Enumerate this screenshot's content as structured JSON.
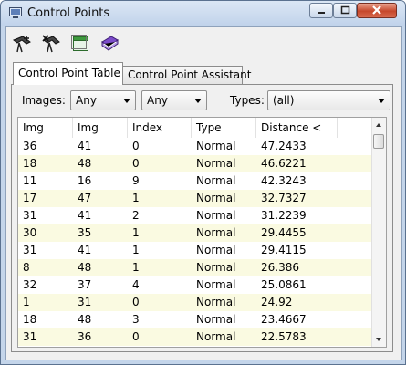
{
  "window": {
    "title": "Control Points"
  },
  "toolbar": {
    "icons": [
      "add-point-icon",
      "remove-point-icon",
      "window-icon",
      "book-icon"
    ]
  },
  "tabs": [
    {
      "label": "Control Point Table",
      "active": true
    },
    {
      "label": "Control Point Assistant",
      "active": false
    }
  ],
  "filters": {
    "images_label": "Images:",
    "images_a": "Any",
    "images_b": "Any",
    "types_label": "Types:",
    "types_value": "(all)"
  },
  "table": {
    "headers": [
      "Img",
      "Img",
      "Index",
      "Type",
      "Distance <"
    ],
    "rows": [
      [
        "36",
        "41",
        "0",
        "Normal",
        "47.2433"
      ],
      [
        "18",
        "48",
        "0",
        "Normal",
        "46.6221"
      ],
      [
        "11",
        "16",
        "9",
        "Normal",
        "42.3243"
      ],
      [
        "17",
        "47",
        "1",
        "Normal",
        "32.7327"
      ],
      [
        "31",
        "41",
        "2",
        "Normal",
        "31.2239"
      ],
      [
        "30",
        "35",
        "1",
        "Normal",
        "29.4455"
      ],
      [
        "31",
        "41",
        "1",
        "Normal",
        "29.4115"
      ],
      [
        "8",
        "48",
        "1",
        "Normal",
        "26.386"
      ],
      [
        "32",
        "37",
        "4",
        "Normal",
        "25.0861"
      ],
      [
        "1",
        "31",
        "0",
        "Normal",
        "24.92"
      ],
      [
        "18",
        "48",
        "3",
        "Normal",
        "23.4667"
      ],
      [
        "31",
        "36",
        "0",
        "Normal",
        "22.5783"
      ]
    ]
  },
  "colors": {
    "row_alt": "#fafae1",
    "title_bar": "#c4d5ea",
    "close_button": "#c6472b"
  }
}
